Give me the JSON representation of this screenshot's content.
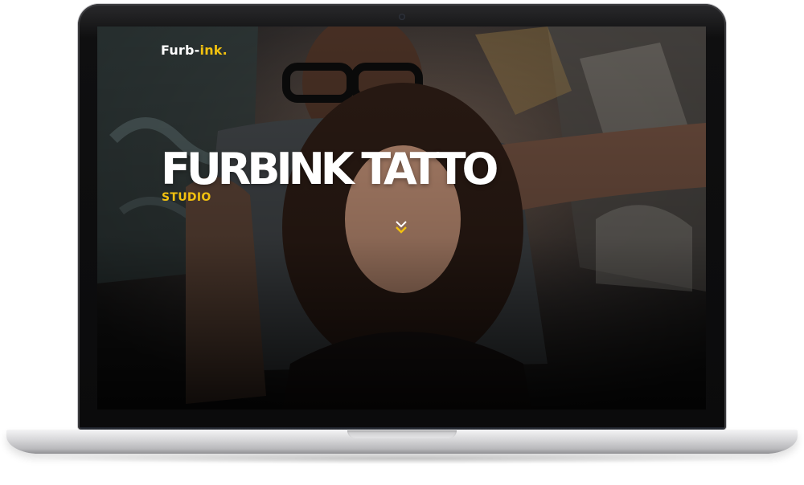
{
  "site": {
    "logo_main": "Furb-",
    "logo_accent": "ink.",
    "hero_title": "FURBINK TATTO",
    "hero_subtitle": "STUDIO"
  },
  "icons": {
    "scroll": "double-chevron-down-icon"
  },
  "colors": {
    "accent": "#f2c10f",
    "text": "#ffffff",
    "screen_bg": "#1a1a1a"
  }
}
